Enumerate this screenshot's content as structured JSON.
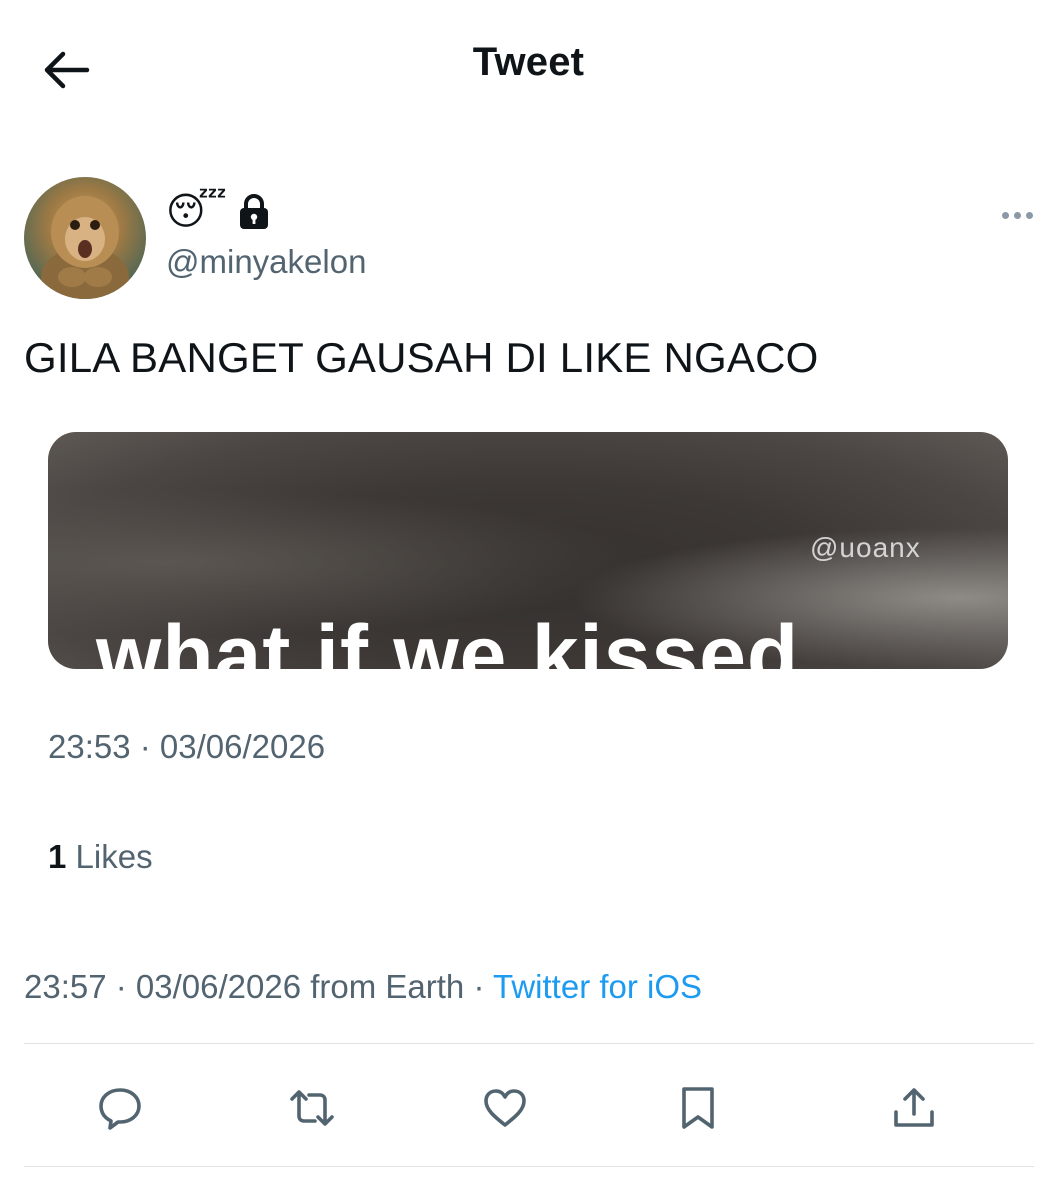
{
  "header": {
    "title": "Tweet"
  },
  "author": {
    "name_emoji": "😴",
    "handle": "@minyakelon",
    "protected": true
  },
  "tweet": {
    "text": "GILA BANGET GAUSAH DI LIKE NGACO",
    "media": {
      "watermark": "@uoanx",
      "caption": "what if we kissed"
    },
    "media_timestamp": "23:53 · 03/06/2026",
    "likes": {
      "count": "1",
      "label": "Likes"
    },
    "meta": {
      "timestamp": "23:57 · 03/06/2026 from Earth · ",
      "source": "Twitter for iOS"
    }
  },
  "actions": [
    "reply-icon",
    "retweet-icon",
    "like-icon",
    "bookmark-icon",
    "share-icon"
  ],
  "colors": {
    "text": "#0f1419",
    "secondary": "#536471",
    "link": "#1d9bf0",
    "divider": "#dfe3e6"
  }
}
